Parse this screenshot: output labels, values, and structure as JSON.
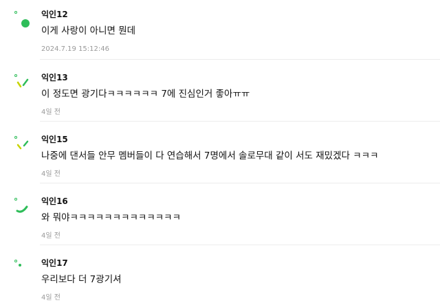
{
  "colors": {
    "accent": "#2ebd59",
    "meta_text": "#999999"
  },
  "comments": [
    {
      "author": "익인12",
      "text": "이게 사랑이 아니면 뭔데",
      "time": "2024.7.19 15:12:46",
      "avatar_icon": "green-dot-icon"
    },
    {
      "author": "익인13",
      "text": "이 정도면 광기다ㅋㅋㅋㅋㅋㅋ 7에 진심인거 좋아ㅠㅠ",
      "time": "4일 전",
      "avatar_icon": "green-check-icon"
    },
    {
      "author": "익인15",
      "text": "나중에 댄서들 안무 멤버들이 다 연습해서 7명에서 솔로무대 같이 서도 재밌겠다 ㅋㅋㅋ",
      "time": "4일 전",
      "avatar_icon": "green-slash-icon"
    },
    {
      "author": "익인16",
      "text": "와 뭐야ㅋㅋㅋㅋㅋㅋㅋㅋㅋㅋㅋㅋㅋ",
      "time": "4일 전",
      "avatar_icon": "green-smile-icon"
    },
    {
      "author": "익인17",
      "text": "우리보다 더 7광기셔",
      "time": "4일 전",
      "avatar_icon": "green-small-dot-icon"
    }
  ]
}
